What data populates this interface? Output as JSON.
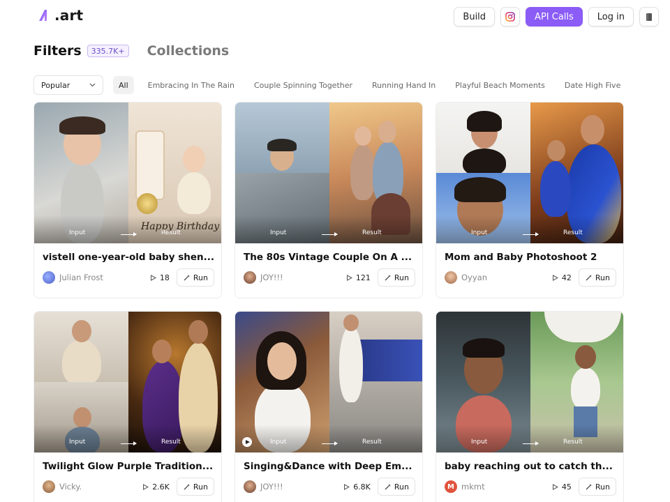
{
  "brand": {
    "logo_text": ".art",
    "accent": "#8b5cf6"
  },
  "header": {
    "build_label": "Build",
    "api_label": "API Calls",
    "login_label": "Log in",
    "instagram_icon": "instagram-icon",
    "menu_icon": "book-icon"
  },
  "filters": {
    "title": "Filters",
    "count_badge": "335.7K+",
    "collections_label": "Collections",
    "sort": {
      "selected": "Popular"
    },
    "chips": [
      "All",
      "Embracing In The Rain",
      "Couple Spinning Together",
      "Running Hand In",
      "Playful Beach Moments",
      "Date High Five"
    ]
  },
  "thumb_labels": {
    "input": "Input",
    "result": "Result"
  },
  "run_label": "Run",
  "cards": [
    {
      "title": "vistell one-year-old baby shen...",
      "author": "Julian Frost",
      "runs": "18",
      "avatar_color": "#4a5fc9"
    },
    {
      "title": "The 80s Vintage Couple On A ...",
      "author": "JOY!!!",
      "runs": "121",
      "avatar_color": "#8a5a3c"
    },
    {
      "title": "Mom and Baby Photoshoot 2",
      "author": "Oyyan",
      "runs": "42",
      "avatar_color": "#b07050"
    },
    {
      "title": "Twilight Glow Purple Tradition...",
      "author": "Vicky.",
      "runs": "2.6K",
      "avatar_color": "#a0704a"
    },
    {
      "title": "Singing&Dance with Deep Em...",
      "author": "JOY!!!",
      "runs": "6.8K",
      "avatar_color": "#8a5a3c"
    },
    {
      "title": "baby reaching out to catch th...",
      "author": "mkmt",
      "runs": "45",
      "avatar_color": "#e0533c",
      "avatar_letter": "M"
    }
  ]
}
